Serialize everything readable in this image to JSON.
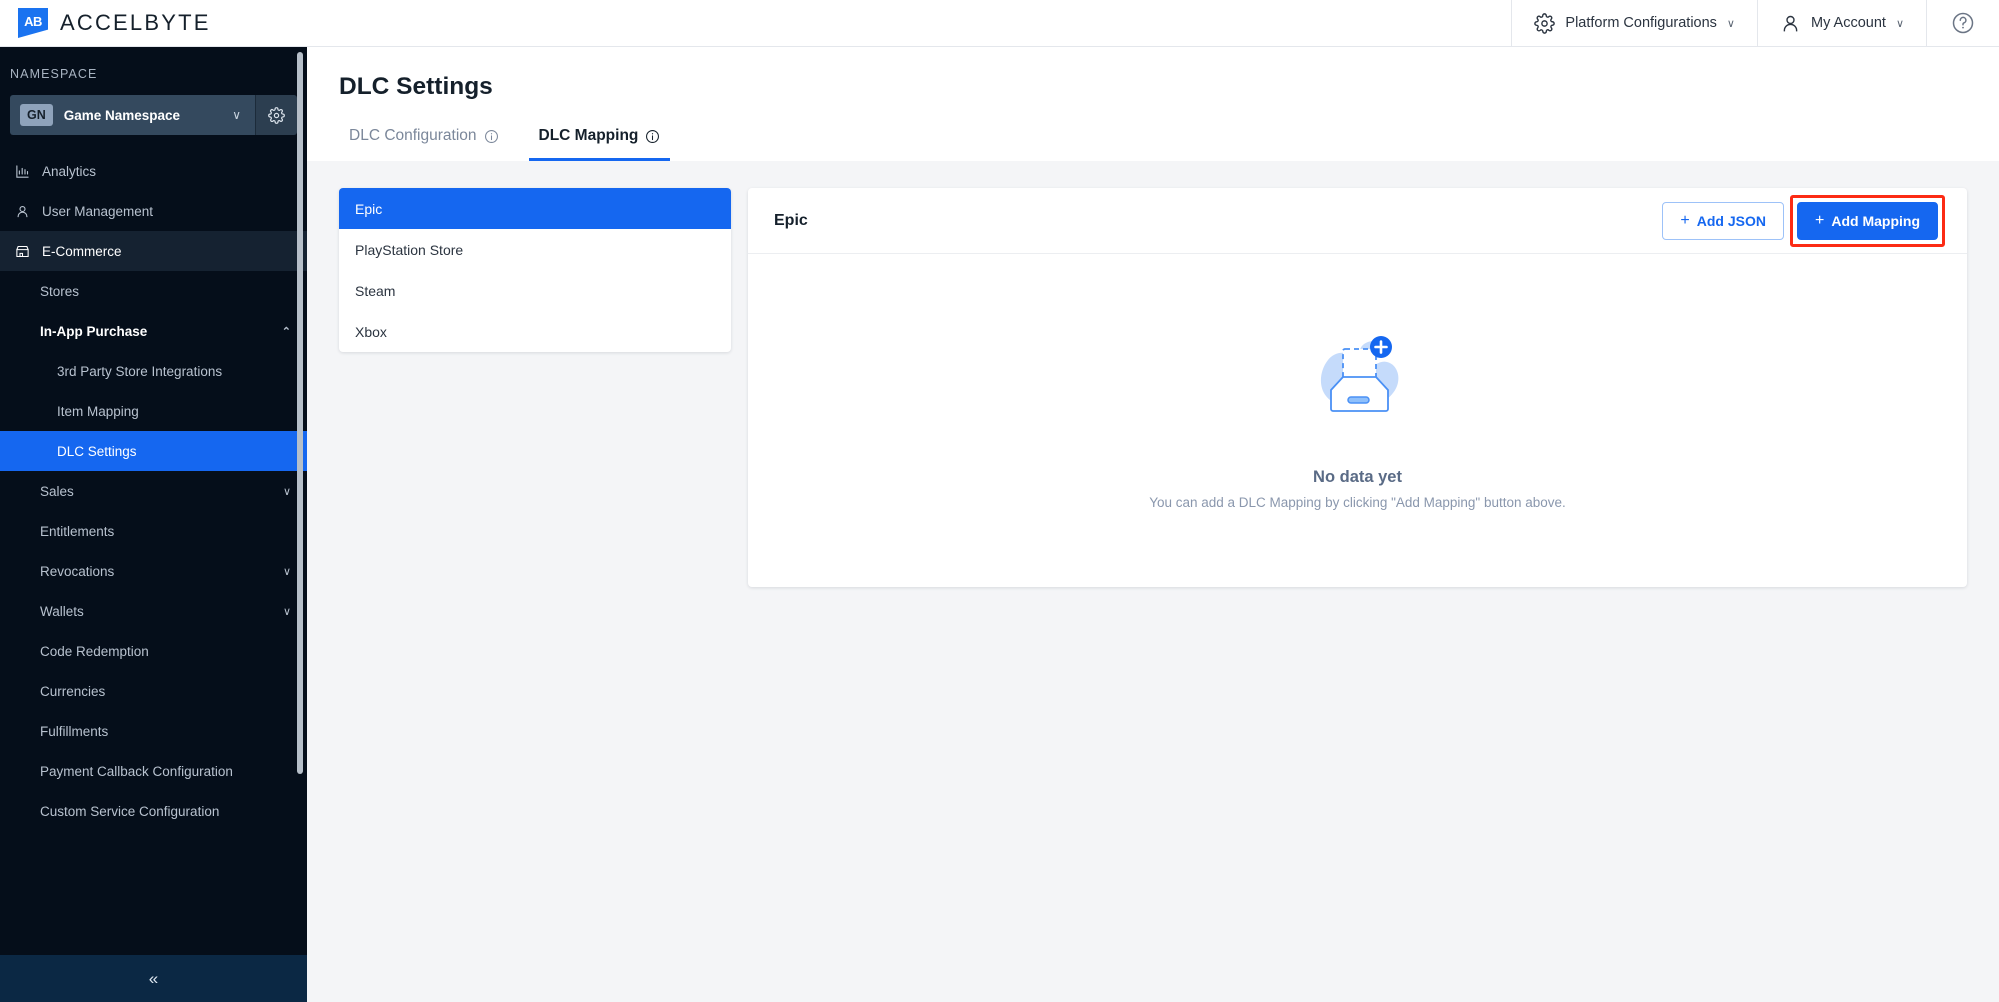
{
  "topbar": {
    "brand_mark": "AB",
    "brand_name": "ACCELBYTE",
    "platform_configurations": "Platform Configurations",
    "my_account": "My Account",
    "caret": "∨",
    "help_label": "?"
  },
  "sidebar": {
    "namespace_label": "NAMESPACE",
    "namespace_badge": "GN",
    "namespace_name": "Game Namespace",
    "namespace_caret": "∨",
    "collapse_glyph": "«",
    "items": [
      {
        "label": "Analytics",
        "level": 1,
        "icon": "chart-icon",
        "state": "normal",
        "chevron": ""
      },
      {
        "label": "User Management",
        "level": 1,
        "icon": "user-icon",
        "state": "normal",
        "chevron": ""
      },
      {
        "label": "E-Commerce",
        "level": 1,
        "icon": "store-icon",
        "state": "active-parent",
        "chevron": ""
      },
      {
        "label": "Stores",
        "level": 2,
        "icon": "",
        "state": "normal",
        "chevron": ""
      },
      {
        "label": "In-App Purchase",
        "level": 2,
        "icon": "",
        "state": "bold",
        "chevron": "⌃"
      },
      {
        "label": "3rd Party Store Integrations",
        "level": 3,
        "icon": "",
        "state": "normal",
        "chevron": ""
      },
      {
        "label": "Item Mapping",
        "level": 3,
        "icon": "",
        "state": "normal",
        "chevron": ""
      },
      {
        "label": "DLC Settings",
        "level": 3,
        "icon": "",
        "state": "active",
        "chevron": ""
      },
      {
        "label": "Sales",
        "level": 2,
        "icon": "",
        "state": "normal",
        "chevron": "∨"
      },
      {
        "label": "Entitlements",
        "level": 2,
        "icon": "",
        "state": "normal",
        "chevron": ""
      },
      {
        "label": "Revocations",
        "level": 2,
        "icon": "",
        "state": "normal",
        "chevron": "∨"
      },
      {
        "label": "Wallets",
        "level": 2,
        "icon": "",
        "state": "normal",
        "chevron": "∨"
      },
      {
        "label": "Code Redemption",
        "level": 2,
        "icon": "",
        "state": "normal",
        "chevron": ""
      },
      {
        "label": "Currencies",
        "level": 2,
        "icon": "",
        "state": "normal",
        "chevron": ""
      },
      {
        "label": "Fulfillments",
        "level": 2,
        "icon": "",
        "state": "normal",
        "chevron": ""
      },
      {
        "label": "Payment Callback Configuration",
        "level": 2,
        "icon": "",
        "state": "normal",
        "chevron": ""
      },
      {
        "label": "Custom Service Configuration",
        "level": 2,
        "icon": "",
        "state": "normal",
        "chevron": ""
      }
    ]
  },
  "main": {
    "page_title": "DLC Settings",
    "tabs": [
      {
        "label": "DLC Configuration",
        "active": false,
        "has_info": true
      },
      {
        "label": "DLC Mapping",
        "active": true,
        "has_info": true
      }
    ],
    "platforms": [
      {
        "label": "Epic",
        "selected": true
      },
      {
        "label": "PlayStation Store",
        "selected": false
      },
      {
        "label": "Steam",
        "selected": false
      },
      {
        "label": "Xbox",
        "selected": false
      }
    ],
    "panel": {
      "title": "Epic",
      "add_json_label": "Add JSON",
      "add_mapping_label": "Add Mapping",
      "plus": "+",
      "highlight_color": "#fc2b14"
    },
    "empty_state": {
      "title": "No data yet",
      "subtitle": "You can add a DLC Mapping by clicking \"Add Mapping\" button above."
    }
  },
  "colors": {
    "accent": "#1567f0",
    "sidebar_bg": "#050e1a",
    "page_bg": "#f4f5f7",
    "highlight": "#fc2b14"
  }
}
